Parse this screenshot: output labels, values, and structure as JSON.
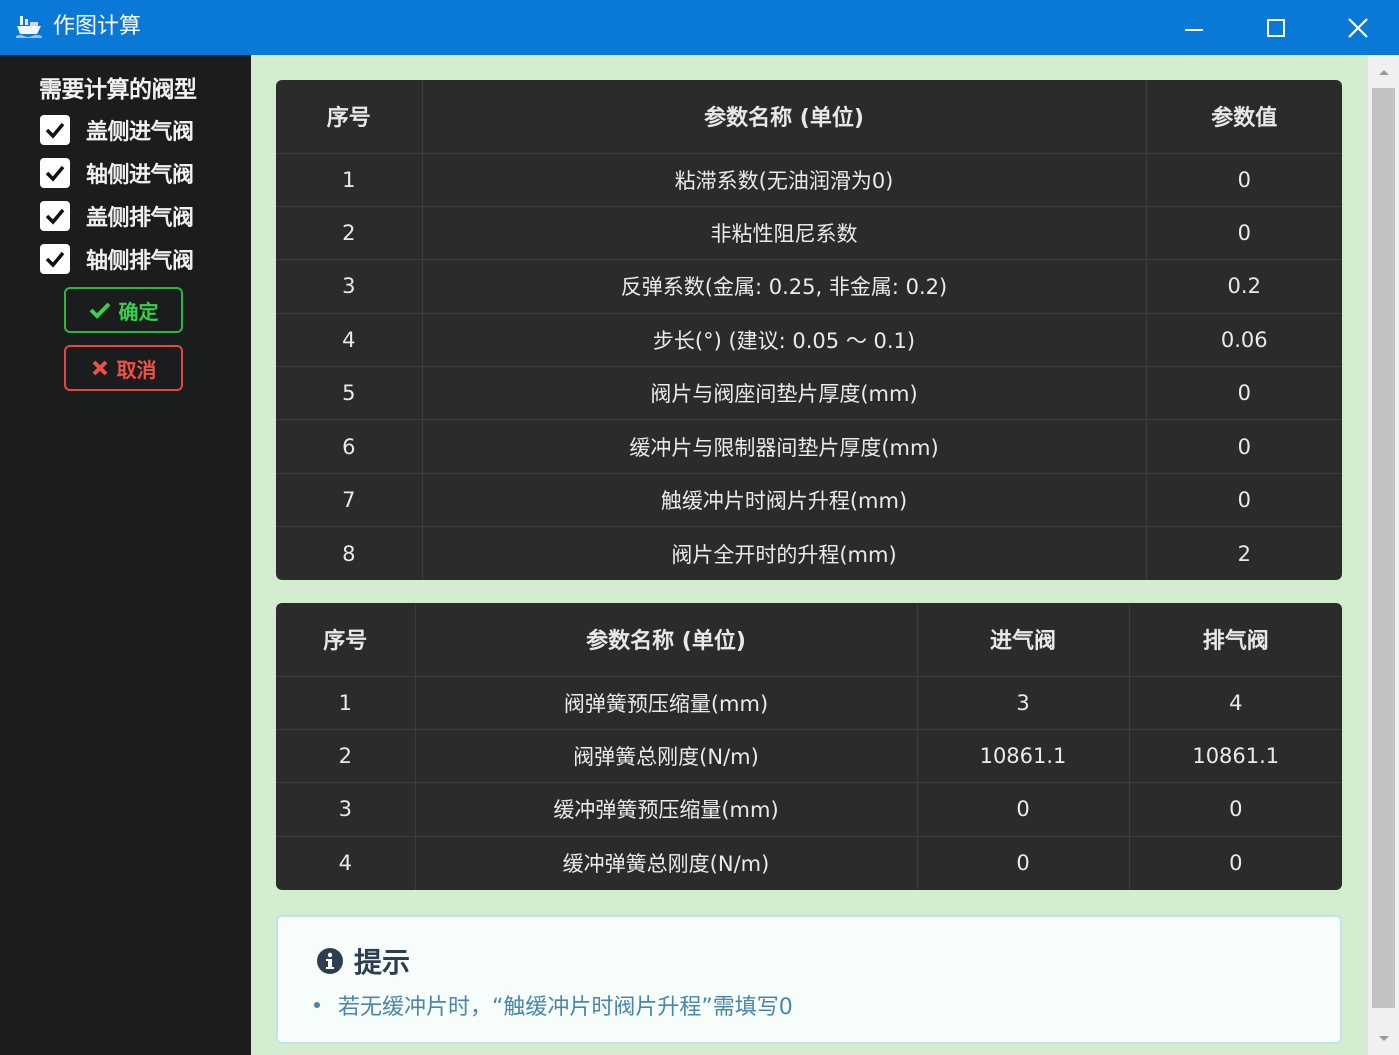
{
  "window": {
    "title": "作图计算",
    "icons": {
      "app": "ship-icon",
      "minimize": "minimize-icon",
      "maximize": "maximize-icon",
      "close": "close-icon"
    }
  },
  "sidebar": {
    "title": "需要计算的阀型",
    "options": [
      {
        "label": "盖侧进气阀",
        "checked": true
      },
      {
        "label": "轴侧进气阀",
        "checked": true
      },
      {
        "label": "盖侧排气阀",
        "checked": true
      },
      {
        "label": "轴侧排气阀",
        "checked": true
      }
    ],
    "confirm_label": "确定",
    "cancel_label": "取消"
  },
  "table1": {
    "headers": [
      "序号",
      "参数名称 (单位)",
      "参数值"
    ],
    "rows": [
      [
        "1",
        "粘滞系数(无油润滑为0)",
        "0"
      ],
      [
        "2",
        "非粘性阻尼系数",
        "0"
      ],
      [
        "3",
        "反弹系数(金属: 0.25, 非金属: 0.2)",
        "0.2"
      ],
      [
        "4",
        "步长(°) (建议: 0.05 ～ 0.1)",
        "0.06"
      ],
      [
        "5",
        "阀片与阀座间垫片厚度(mm)",
        "0"
      ],
      [
        "6",
        "缓冲片与限制器间垫片厚度(mm)",
        "0"
      ],
      [
        "7",
        "触缓冲片时阀片升程(mm)",
        "0"
      ],
      [
        "8",
        "阀片全开时的升程(mm)",
        "2"
      ]
    ]
  },
  "table2": {
    "headers": [
      "序号",
      "参数名称 (单位)",
      "进气阀",
      "排气阀"
    ],
    "rows": [
      [
        "1",
        "阀弹簧预压缩量(mm)",
        "3",
        "4"
      ],
      [
        "2",
        "阀弹簧总刚度(N/m)",
        "10861.1",
        "10861.1"
      ],
      [
        "3",
        "缓冲弹簧预压缩量(mm)",
        "0",
        "0"
      ],
      [
        "4",
        "缓冲弹簧总刚度(N/m)",
        "0",
        "0"
      ]
    ]
  },
  "tip": {
    "title": "提示",
    "icon": "info-icon",
    "items": [
      "若无缓冲片时，“触缓冲片时阀片升程”需填写0"
    ]
  },
  "colors": {
    "titlebar": "#0a78d6",
    "sidebar": "#1b1c1e",
    "main_bg": "#d4ecd0",
    "table_bg": "#2b2b2b",
    "confirm": "#2cb63c",
    "cancel": "#e0493e"
  }
}
